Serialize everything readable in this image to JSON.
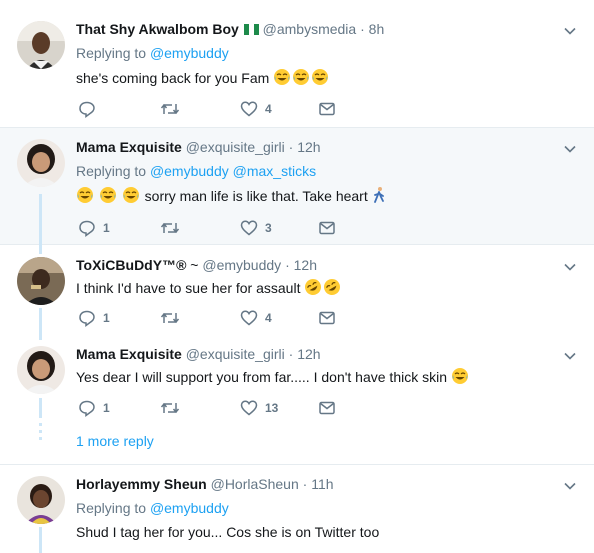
{
  "tweets": [
    {
      "name": "That Shy Akwalbom Boy",
      "handle": "@ambysmedia",
      "time": "8h",
      "replying_label": "Replying to",
      "replying_to": [
        "@emybuddy"
      ],
      "text": "she's coming back for you Fam",
      "emojis": [
        "tears-of-joy-emoji",
        "tears-of-joy-emoji",
        "tears-of-joy-emoji"
      ],
      "counts": {
        "reply": "",
        "retweet": "",
        "like": "4"
      }
    },
    {
      "name": "Mama Exquisite",
      "handle": "@exquisite_girli",
      "time": "12h",
      "replying_label": "Replying to",
      "replying_to": [
        "@emybuddy",
        "@max_sticks"
      ],
      "text": "sorry man life is like that. Take heart",
      "counts": {
        "reply": "1",
        "retweet": "",
        "like": "3"
      }
    },
    {
      "name": "ToXiCBuDdY™®",
      "name_suffix": "~",
      "handle": "@emybuddy",
      "time": "12h",
      "text": "I think I'd have to sue her for assault",
      "counts": {
        "reply": "1",
        "retweet": "",
        "like": "4"
      }
    },
    {
      "name": "Mama Exquisite",
      "handle": "@exquisite_girli",
      "time": "12h",
      "text": "Yes dear I will support you from far..... I don't have thick skin",
      "counts": {
        "reply": "1",
        "retweet": "",
        "like": "13"
      }
    },
    {
      "name": "Horlayemmy Sheun",
      "handle": "@HorlaSheun",
      "time": "11h",
      "replying_label": "Replying to",
      "replying_to": [
        "@emybuddy"
      ],
      "text": "Shud I tag her for you... Cos she is on Twitter too"
    }
  ],
  "more_replies": "1 more reply",
  "colors": {
    "accent": "#1da1f2",
    "muted": "#657786",
    "thread": "#cde6f7",
    "highlight_bg": "#f5f8fa"
  },
  "icons": [
    "reply-icon",
    "retweet-icon",
    "like-icon",
    "message-icon",
    "caret-down-icon",
    "nigeria-flag-icon"
  ]
}
